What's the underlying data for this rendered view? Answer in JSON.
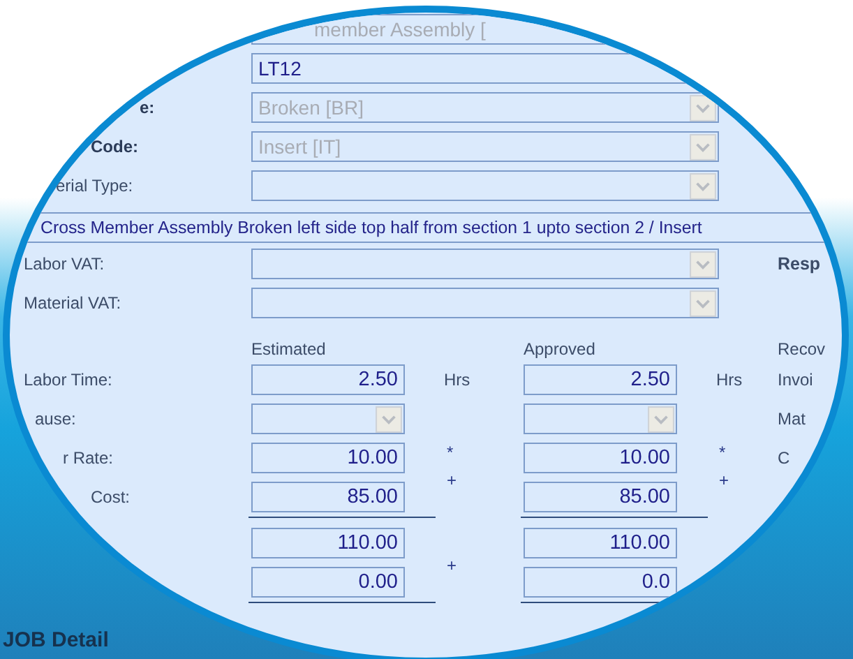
{
  "top_field": {
    "value": "member Assembly [",
    "disabled": true
  },
  "fields": [
    {
      "kind": "text",
      "value": "LT12",
      "disabled": false
    },
    {
      "label": "e:",
      "kind": "select",
      "value": "Broken [BR]",
      "disabled": true,
      "strong": true
    },
    {
      "label": "Code:",
      "kind": "select",
      "value": "Insert [IT]",
      "disabled": true,
      "strong": true
    },
    {
      "label": "erial Type:",
      "kind": "select",
      "strong": false
    }
  ],
  "description": "Cross Member Assembly Broken left side top half from section 1 upto section 2 / Insert",
  "vat_fields": [
    {
      "label": "Labor VAT:",
      "side": "Resp",
      "side_strong": true
    },
    {
      "label": "Material VAT:"
    }
  ],
  "cost_headers": {
    "estimated": "Estimated",
    "approved": "Approved",
    "side": "Recov"
  },
  "cost_rows": [
    {
      "label": "Labor Time:",
      "kind": "number",
      "estimated": "2.50",
      "approved": "2.50",
      "unit_estimated": "Hrs",
      "unit_approved": "Hrs",
      "side": "Invoi",
      "total_line": false
    },
    {
      "label": "ause:",
      "kind": "select",
      "side": "Mat",
      "total_line": false
    },
    {
      "label": "r Rate:",
      "kind": "number",
      "estimated": "10.00",
      "approved": "10.00",
      "operator_estimated": "*",
      "operator_approved": "*",
      "side": "C",
      "total_line": false
    },
    {
      "label": "Cost:",
      "kind": "number",
      "estimated": "85.00",
      "approved": "85.00",
      "operator_estimated": "+",
      "operator_approved": "+",
      "total_line": true
    },
    {
      "kind": "number",
      "estimated": "110.00",
      "approved": "110.00",
      "total_line": false
    },
    {
      "kind": "number",
      "estimated": "0.00",
      "approved": "0.0",
      "operator_estimated": "+",
      "total_line": true
    }
  ],
  "section_title": "JOB Detail"
}
